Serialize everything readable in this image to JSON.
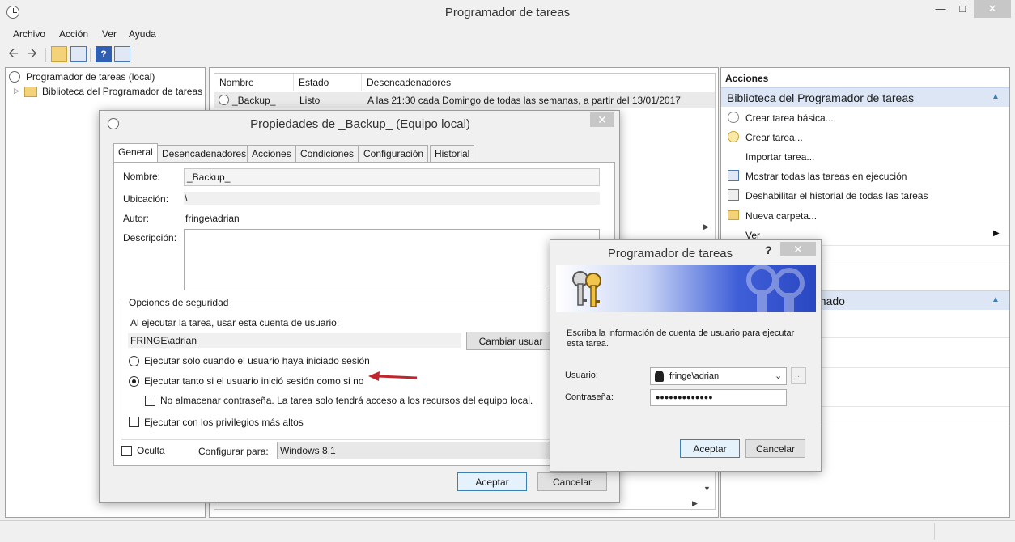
{
  "window": {
    "title": "Programador de tareas"
  },
  "menu": [
    "Archivo",
    "Acción",
    "Ver",
    "Ayuda"
  ],
  "tree": {
    "root": "Programador de tareas (local)",
    "child": "Biblioteca del Programador de tareas"
  },
  "task_list": {
    "columns": [
      "Nombre",
      "Estado",
      "Desencadenadores"
    ],
    "rows": [
      {
        "name": "_Backup_",
        "status": "Listo",
        "trigger": "A las 21:30 cada Domingo de todas las semanas, a partir del 13/01/2017"
      }
    ]
  },
  "actions": {
    "header": "Acciones",
    "section1": "Biblioteca del Programador de tareas",
    "items": [
      "Crear tarea básica...",
      "Crear tarea...",
      "Importar tarea...",
      "Mostrar todas las tareas en ejecución",
      "Deshabilitar el historial de todas las tareas",
      "Nueva carpeta...",
      "Ver"
    ],
    "section2_partial": "onado"
  },
  "properties": {
    "title": "Propiedades de _Backup_ (Equipo local)",
    "tabs": [
      "General",
      "Desencadenadores",
      "Acciones",
      "Condiciones",
      "Configuración",
      "Historial"
    ],
    "name_label": "Nombre:",
    "name_value": "_Backup_",
    "location_label": "Ubicación:",
    "location_value": "\\",
    "author_label": "Autor:",
    "author_value": "fringe\\adrian",
    "description_label": "Descripción:",
    "security_title": "Opciones de seguridad",
    "run_as_text": "Al ejecutar la tarea, usar esta cuenta de usuario:",
    "run_as_value": "FRINGE\\adrian",
    "change_user_btn": "Cambiar usuar",
    "radio_logged": "Ejecutar solo cuando el usuario haya iniciado sesión",
    "radio_always": "Ejecutar tanto si el usuario inició sesión como si no",
    "no_store_pwd": "No almacenar contraseña. La tarea solo tendrá acceso a los recursos del equipo local.",
    "highest_priv": "Ejecutar con los privilegios más altos",
    "hidden": "Oculta",
    "configure_label": "Configurar para:",
    "configure_value": "Windows 8.1",
    "ok": "Aceptar",
    "cancel": "Cancelar"
  },
  "credentials": {
    "title": "Programador de tareas",
    "help": "?",
    "prompt": "Escriba la información de cuenta de usuario para ejecutar esta tarea.",
    "user_label": "Usuario:",
    "user_value": "fringe\\adrian",
    "browse": "...",
    "password_label": "Contraseña:",
    "password_value": "●●●●●●●●●●●●●",
    "ok": "Aceptar",
    "cancel": "Cancelar"
  },
  "colors": {
    "accent_blue": "#3c7fb1",
    "arrow_red": "#c0262d",
    "section_bg": "#dce6f4"
  }
}
